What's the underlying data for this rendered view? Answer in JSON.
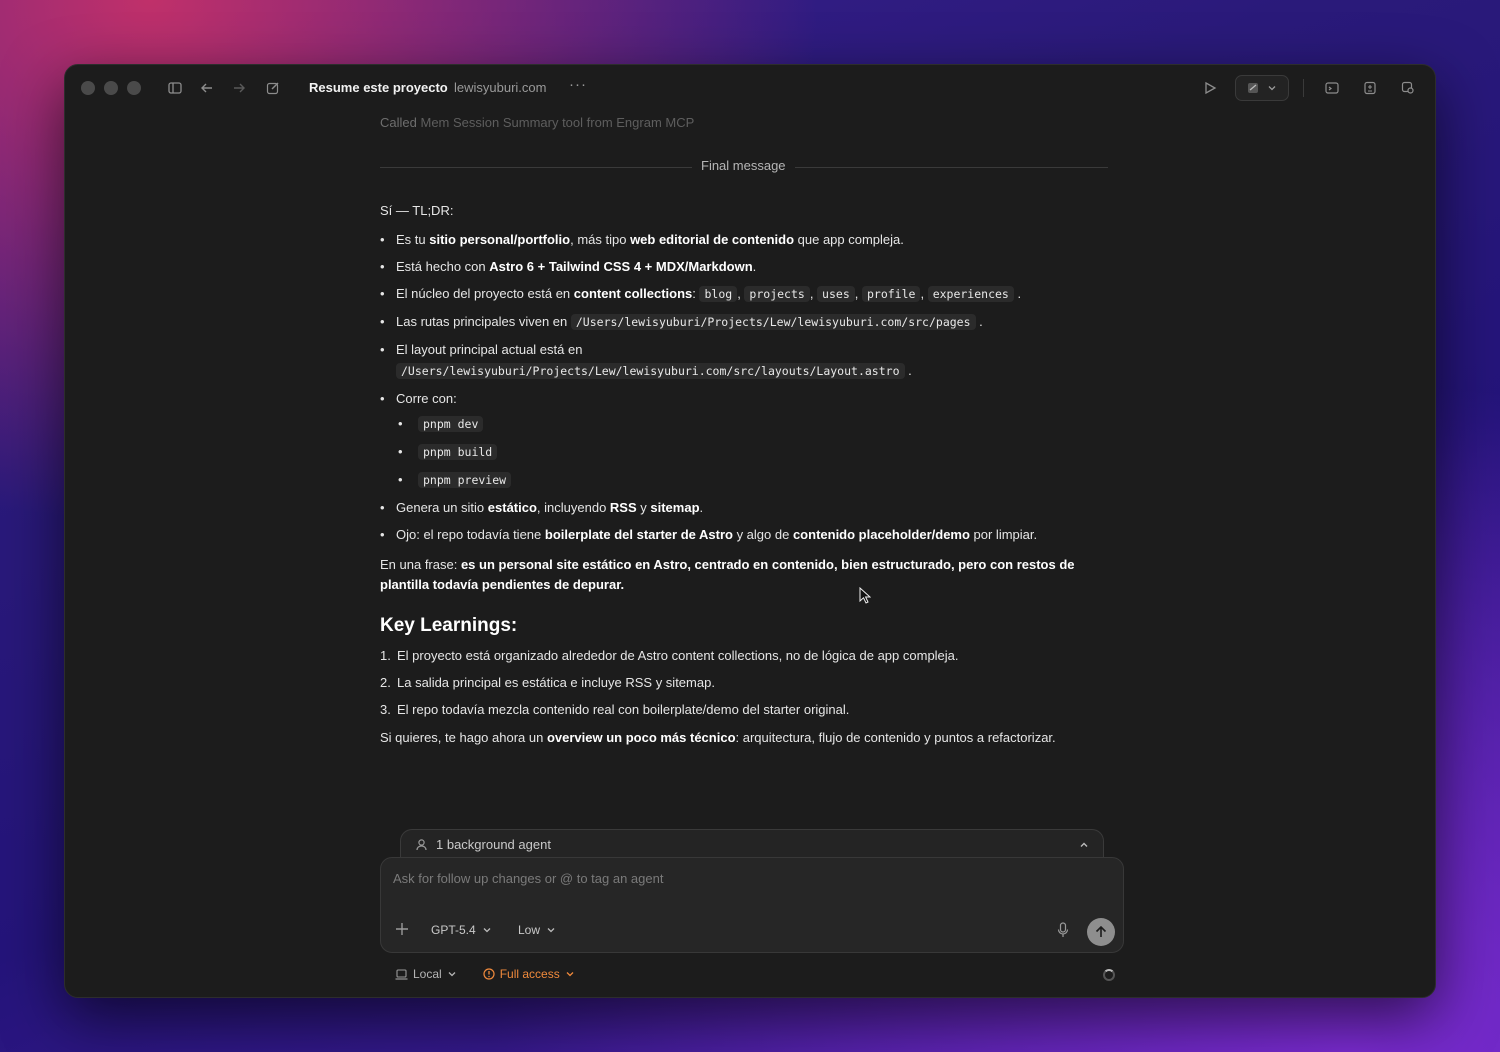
{
  "window": {
    "title": "Resume este proyecto",
    "subtitle": "lewisyuburi.com",
    "more": "···"
  },
  "transcript": {
    "called_prefix": "Called",
    "called_rest": "Mem Session Summary tool from Engram MCP",
    "divider_label": "Final message",
    "intro": "Sí — TL;DR:",
    "bullets": {
      "b1_pre": "Es tu ",
      "b1_s1": "sitio personal/portfolio",
      "b1_mid": ", más tipo ",
      "b1_s2": "web editorial de contenido",
      "b1_post": " que app compleja.",
      "b2_pre": "Está hecho con ",
      "b2_s1": "Astro 6 + Tailwind CSS 4 + MDX/Markdown",
      "b2_post": ".",
      "b3_pre": "El núcleo del proyecto está en ",
      "b3_s1": "content collections",
      "b3_colon": ": ",
      "b3_codes": [
        "blog",
        "projects",
        "uses",
        "profile",
        "experiences"
      ],
      "b3_post": ".",
      "b4_pre": "Las rutas principales viven en ",
      "b4_code": "/Users/lewisyuburi/Projects/Lew/lewisyuburi.com/src/pages",
      "b4_post": ".",
      "b5_pre": "El layout principal actual está en",
      "b5_code": "/Users/lewisyuburi/Projects/Lew/lewisyuburi.com/src/layouts/Layout.astro",
      "b5_post": ".",
      "b6_pre": "Corre con:",
      "b6_cmds": [
        "pnpm dev",
        "pnpm build",
        "pnpm preview"
      ],
      "b7_pre": "Genera un sitio ",
      "b7_s1": "estático",
      "b7_mid": ", incluyendo ",
      "b7_s2": "RSS",
      "b7_mid2": " y ",
      "b7_s3": "sitemap",
      "b7_post": ".",
      "b8_pre": "Ojo: el repo todavía tiene ",
      "b8_s1": "boilerplate del starter de Astro",
      "b8_mid": " y algo de ",
      "b8_s2": "contenido placeholder/demo",
      "b8_post": " por limpiar."
    },
    "phrase_pre": "En una frase: ",
    "phrase_strong": "es un personal site estático en Astro, centrado en contenido, bien estructurado, pero con restos de plantilla todavía pendientes de depurar.",
    "heading": "Key Learnings:",
    "learnings": [
      "El proyecto está organizado alrededor de Astro content collections, no de lógica de app compleja.",
      "La salida principal es estática e incluye RSS y sitemap.",
      "El repo todavía mezcla contenido real con boilerplate/demo del starter original."
    ],
    "closing_pre": "Si quieres, te hago ahora un ",
    "closing_strong": "overview un poco más técnico",
    "closing_post": ": arquitectura, flujo de contenido y puntos a refactorizar."
  },
  "agents": {
    "label": "1 background agent"
  },
  "composer": {
    "placeholder": "Ask for follow up changes or @ to tag an agent",
    "model": "GPT-5.4",
    "effort": "Low"
  },
  "footer": {
    "env": "Local",
    "access": "Full access"
  },
  "colors": {
    "window_bg": "#1c1c1c",
    "warning": "#f08a3c"
  }
}
